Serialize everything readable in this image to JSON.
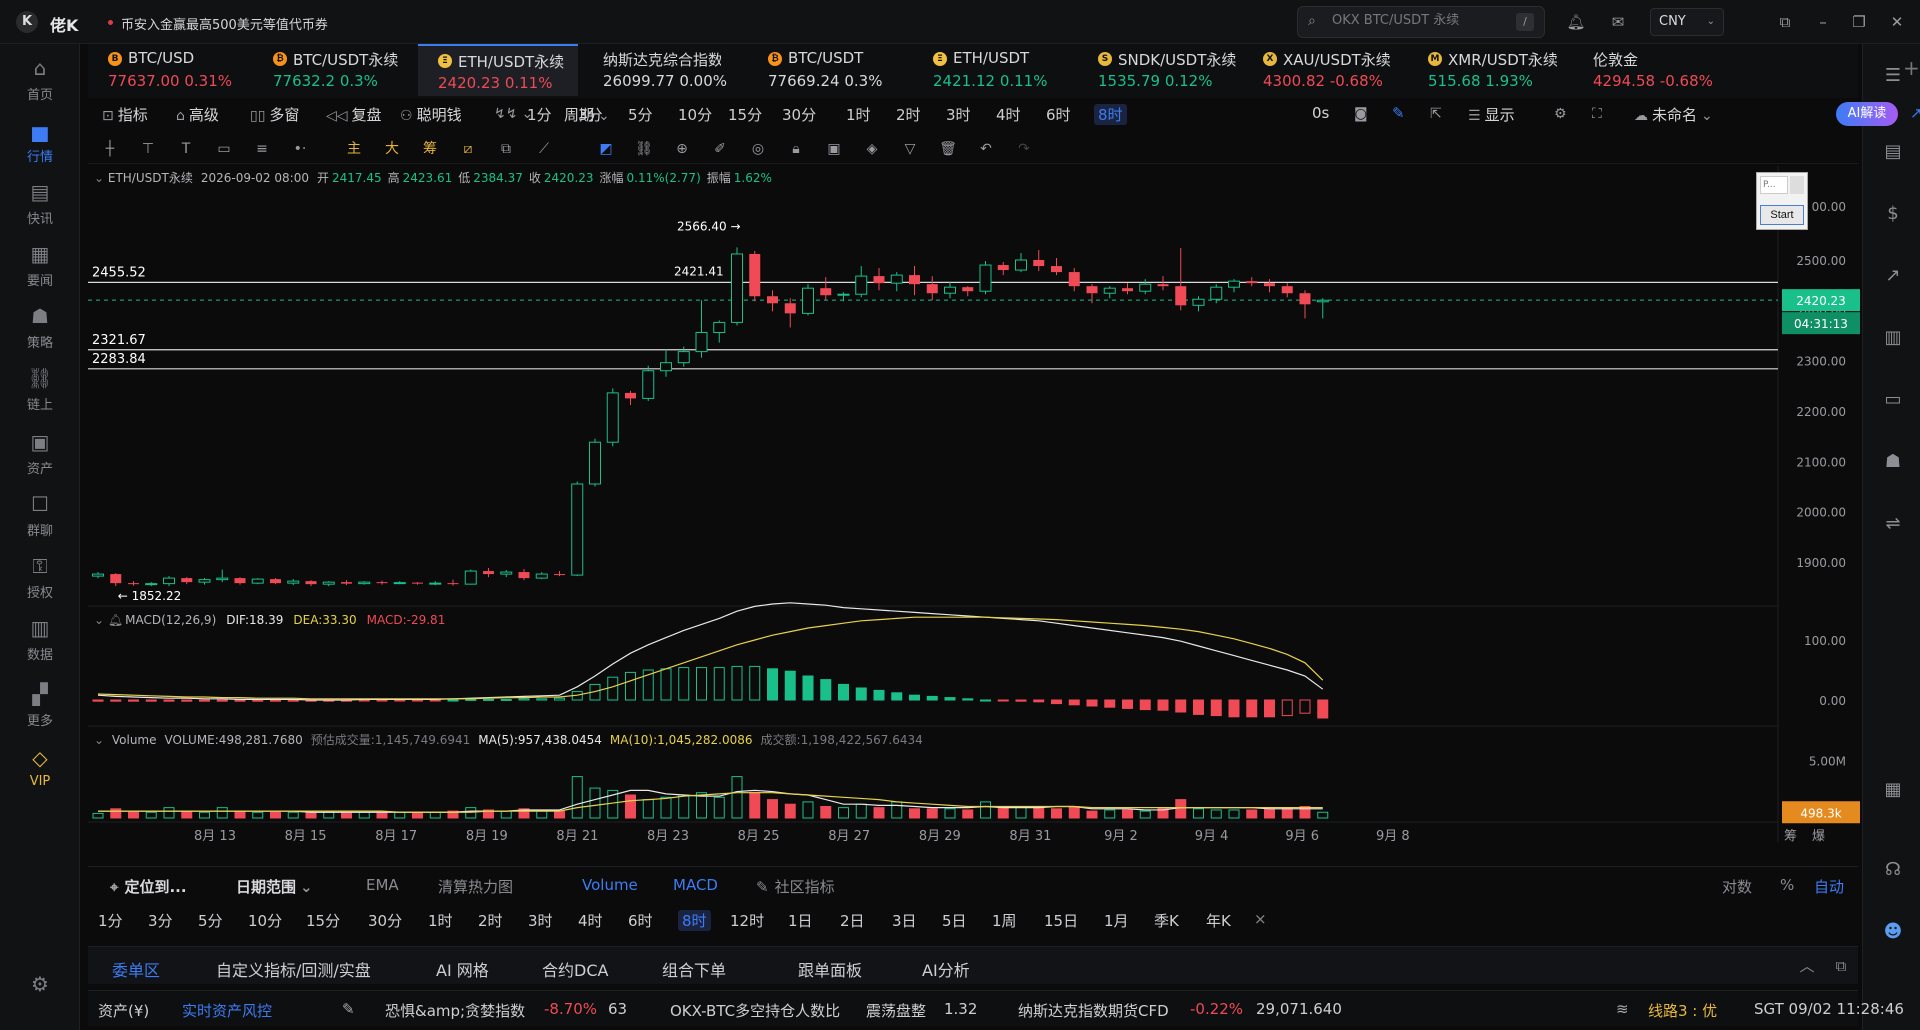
{
  "app": {
    "title": "佬K",
    "logo": "K"
  },
  "headline": "币安入金赢最高500美元等值代币券",
  "search": {
    "placeholder": "OKX BTC/USDT 永续",
    "shortcut": "/"
  },
  "currency": "CNY",
  "sidebar": [
    {
      "label": "首页",
      "icon": "home-icon"
    },
    {
      "label": "行情",
      "icon": "chart-bars-icon",
      "active": true
    },
    {
      "label": "快讯",
      "icon": "news-icon"
    },
    {
      "label": "要闻",
      "icon": "article-icon"
    },
    {
      "label": "策略",
      "icon": "robot-icon"
    },
    {
      "label": "链上",
      "icon": "chain-icon"
    },
    {
      "label": "资产",
      "icon": "wallet-icon"
    },
    {
      "label": "群聊",
      "icon": "chat-icon"
    },
    {
      "label": "授权",
      "icon": "key-icon"
    },
    {
      "label": "数据",
      "icon": "data-icon"
    },
    {
      "label": "更多",
      "icon": "grid-icon"
    },
    {
      "label": "VIP",
      "icon": "diamond-icon"
    }
  ],
  "tickers": [
    {
      "name": "BTC/USD",
      "price": "77637.00",
      "change": "0.31%",
      "dir": "dn",
      "icon": "B",
      "color": "#f7931a"
    },
    {
      "name": "BTC/USDT永续",
      "price": "77632.2",
      "change": "0.3%",
      "dir": "up",
      "icon": "₿",
      "color": "#f7931a"
    },
    {
      "name": "ETH/USDT永续",
      "price": "2420.23",
      "change": "0.11%",
      "dir": "dn",
      "icon": "Ξ",
      "color": "#f0c040",
      "active": true
    },
    {
      "name": "纳斯达克综合指数",
      "price": "26099.77",
      "change": "0.00%",
      "dir": "flat",
      "icon": ""
    },
    {
      "name": "BTC/USDT",
      "price": "77669.24",
      "change": "0.3%",
      "dir": "flat",
      "icon": "₿",
      "color": "#f7931a"
    },
    {
      "name": "ETH/USDT",
      "price": "2421.12",
      "change": "0.11%",
      "dir": "up",
      "icon": "Ξ",
      "color": "#f0c040"
    },
    {
      "name": "SNDK/USDT永续",
      "price": "1535.79",
      "change": "0.12%",
      "dir": "up",
      "icon": "S",
      "color": "#e6b93c"
    },
    {
      "name": "XAU/USDT永续",
      "price": "4300.82",
      "change": "-0.68%",
      "dir": "dn",
      "icon": "X",
      "color": "#e6b93c"
    },
    {
      "name": "XMR/USDT永续",
      "price": "515.68",
      "change": "1.93%",
      "dir": "up",
      "icon": "M",
      "color": "#e6b93c"
    },
    {
      "name": "伦敦金",
      "price": "4294.58",
      "change": "-0.68%",
      "dir": "dn",
      "icon": ""
    }
  ],
  "toolbar": {
    "indicators": "指标",
    "advanced": "高级",
    "multi": "多窗",
    "replay": "复盘",
    "smart": "聪明钱",
    "period": "周期",
    "periods": [
      "1分",
      "3分",
      "5分",
      "10分",
      "15分",
      "30分",
      "1时",
      "2时",
      "3时",
      "4时",
      "6时",
      "8时"
    ],
    "active_period": "8时",
    "countdown": "0s",
    "display": "显示",
    "unnamed": "未命名",
    "ai": "AI解读"
  },
  "chart_info": {
    "symbol": "ETH/USDT永续",
    "time": "2026-09-02 08:00",
    "open_label": "开",
    "open": "2417.45",
    "high_label": "高",
    "high": "2423.61",
    "low_label": "低",
    "low": "2384.37",
    "close_label": "收",
    "close": "2420.23",
    "change_label": "涨幅",
    "change": "0.11%(2.77)",
    "amp_label": "振幅",
    "amp": "1.62%"
  },
  "macd_info": {
    "name": "MACD(12,26,9)",
    "dif": "DIF:18.39",
    "dea": "DEA:33.30",
    "macd": "MACD:-29.81"
  },
  "volume_info": {
    "name": "Volume",
    "volume": "VOLUME:498,281.7680",
    "est": "预估成交量:1,145,749.6941",
    "ma5": "MA(5):957,438.0454",
    "ma10": "MA(10):1,045,282.0086",
    "turnover": "成交额:1,198,422,567.6434"
  },
  "price_labels": {
    "current": "2420.23",
    "countdown": "04:31:13",
    "volume_last": "498.3k",
    "lines": [
      "2455.52",
      "2321.67",
      "2283.84"
    ],
    "high_mark": "2566.40",
    "low_mark": "1852.22",
    "mid_mark": "2421.41"
  },
  "chart_data": {
    "type": "candlestick",
    "ylim": [
      1850,
      2600
    ],
    "yticks": [
      "2500.00",
      "2400.00",
      "2300.00",
      "2200.00",
      "2100.00",
      "2000.00",
      "1900.00"
    ],
    "top_tick": "00.00",
    "macd_ticks": [
      "100.00",
      "0.00"
    ],
    "vol_ticks": [
      "5.00M"
    ],
    "xticks": [
      "8月 13",
      "8月 15",
      "8月 17",
      "8月 19",
      "8月 21",
      "8月 23",
      "8月 25",
      "8月 27",
      "8月 29",
      "8月 31",
      "9月 2",
      "9月 4",
      "9月 6",
      "9月 8"
    ],
    "candles": [
      [
        1872,
        1880,
        1868,
        1876
      ],
      [
        1876,
        1878,
        1852,
        1858
      ],
      [
        1858,
        1862,
        1853,
        1856
      ],
      [
        1856,
        1860,
        1852,
        1857
      ],
      [
        1857,
        1872,
        1852,
        1868
      ],
      [
        1868,
        1870,
        1856,
        1860
      ],
      [
        1860,
        1868,
        1855,
        1865
      ],
      [
        1865,
        1885,
        1860,
        1868
      ],
      [
        1868,
        1870,
        1855,
        1858
      ],
      [
        1858,
        1868,
        1856,
        1866
      ],
      [
        1866,
        1868,
        1856,
        1858
      ],
      [
        1858,
        1866,
        1854,
        1862
      ],
      [
        1862,
        1864,
        1852,
        1856
      ],
      [
        1856,
        1862,
        1852,
        1860
      ],
      [
        1860,
        1864,
        1854,
        1857
      ],
      [
        1857,
        1862,
        1855,
        1860
      ],
      [
        1860,
        1863,
        1855,
        1858
      ],
      [
        1858,
        1862,
        1856,
        1859
      ],
      [
        1859,
        1860,
        1855,
        1857
      ],
      [
        1857,
        1862,
        1854,
        1858
      ],
      [
        1858,
        1865,
        1853,
        1856
      ],
      [
        1856,
        1885,
        1855,
        1882
      ],
      [
        1882,
        1888,
        1870,
        1876
      ],
      [
        1876,
        1884,
        1870,
        1880
      ],
      [
        1880,
        1886,
        1864,
        1868
      ],
      [
        1868,
        1880,
        1866,
        1876
      ],
      [
        1876,
        1882,
        1872,
        1874
      ],
      [
        1874,
        2060,
        1872,
        2055
      ],
      [
        2055,
        2145,
        2050,
        2138
      ],
      [
        2138,
        2245,
        2130,
        2236
      ],
      [
        2236,
        2240,
        2212,
        2225
      ],
      [
        2225,
        2290,
        2220,
        2280
      ],
      [
        2280,
        2322,
        2268,
        2296
      ],
      [
        2296,
        2328,
        2288,
        2318
      ],
      [
        2318,
        2420,
        2306,
        2356
      ],
      [
        2356,
        2380,
        2336,
        2376
      ],
      [
        2376,
        2525,
        2370,
        2512
      ],
      [
        2512,
        2518,
        2418,
        2428
      ],
      [
        2428,
        2440,
        2398,
        2414
      ],
      [
        2414,
        2424,
        2366,
        2394
      ],
      [
        2394,
        2452,
        2390,
        2444
      ],
      [
        2444,
        2466,
        2420,
        2430
      ],
      [
        2430,
        2436,
        2418,
        2432
      ],
      [
        2432,
        2488,
        2426,
        2468
      ],
      [
        2468,
        2484,
        2440,
        2454
      ],
      [
        2454,
        2476,
        2438,
        2470
      ],
      [
        2470,
        2488,
        2430,
        2452
      ],
      [
        2452,
        2468,
        2420,
        2434
      ],
      [
        2434,
        2456,
        2424,
        2446
      ],
      [
        2446,
        2448,
        2428,
        2438
      ],
      [
        2438,
        2498,
        2432,
        2490
      ],
      [
        2490,
        2496,
        2470,
        2480
      ],
      [
        2480,
        2514,
        2476,
        2500
      ],
      [
        2500,
        2520,
        2478,
        2488
      ],
      [
        2488,
        2504,
        2470,
        2476
      ],
      [
        2476,
        2484,
        2438,
        2448
      ],
      [
        2448,
        2452,
        2414,
        2434
      ],
      [
        2434,
        2448,
        2424,
        2444
      ],
      [
        2444,
        2454,
        2432,
        2438
      ],
      [
        2438,
        2462,
        2432,
        2452
      ],
      [
        2452,
        2468,
        2440,
        2448
      ],
      [
        2448,
        2524,
        2400,
        2410
      ],
      [
        2410,
        2428,
        2398,
        2422
      ],
      [
        2422,
        2452,
        2414,
        2446
      ],
      [
        2446,
        2462,
        2436,
        2458
      ],
      [
        2458,
        2466,
        2448,
        2454
      ],
      [
        2454,
        2462,
        2436,
        2448
      ],
      [
        2448,
        2454,
        2426,
        2434
      ],
      [
        2434,
        2440,
        2384,
        2412
      ],
      [
        2417,
        2424,
        2384,
        2420
      ]
    ],
    "macd_dif": [
      8,
      6,
      5,
      4,
      3,
      3,
      2,
      2,
      1,
      1,
      1,
      1,
      0,
      0,
      0,
      1,
      1,
      1,
      1,
      1,
      2,
      3,
      4,
      5,
      6,
      7,
      8,
      22,
      40,
      60,
      78,
      92,
      104,
      116,
      126,
      136,
      148,
      156,
      160,
      162,
      160,
      158,
      154,
      152,
      150,
      148,
      146,
      144,
      142,
      140,
      138,
      136,
      134,
      132,
      128,
      124,
      120,
      116,
      112,
      108,
      104,
      98,
      90,
      82,
      74,
      66,
      58,
      50,
      40,
      18
    ],
    "macd_dea": [
      10,
      9,
      8,
      7,
      6,
      5,
      5,
      4,
      4,
      3,
      3,
      3,
      2,
      2,
      2,
      2,
      2,
      2,
      2,
      2,
      2,
      2,
      3,
      4,
      4,
      5,
      5,
      8,
      14,
      22,
      32,
      42,
      52,
      62,
      72,
      82,
      92,
      100,
      108,
      114,
      120,
      124,
      128,
      132,
      134,
      136,
      138,
      138,
      138,
      138,
      138,
      137,
      136,
      135,
      134,
      132,
      130,
      128,
      126,
      124,
      121,
      118,
      114,
      108,
      102,
      94,
      86,
      76,
      62,
      33
    ],
    "macd_hist": [
      -2,
      -2,
      -2,
      -2,
      -2,
      -2,
      -2,
      -2,
      -2,
      -2,
      -2,
      -2,
      -2,
      -2,
      -2,
      -1,
      -1,
      -1,
      -1,
      -1,
      0,
      1,
      1,
      1,
      2,
      2,
      3,
      14,
      26,
      38,
      46,
      50,
      52,
      54,
      54,
      54,
      56,
      56,
      52,
      48,
      40,
      34,
      26,
      20,
      16,
      12,
      8,
      6,
      4,
      2,
      0,
      -1,
      -2,
      -3,
      -6,
      -8,
      -10,
      -12,
      -14,
      -16,
      -17,
      -20,
      -24,
      -26,
      -28,
      -28,
      -28,
      -26,
      -22,
      -30
    ],
    "volume": [
      0.4,
      0.8,
      0.5,
      0.5,
      0.9,
      0.6,
      0.5,
      0.9,
      0.6,
      0.5,
      0.5,
      0.5,
      0.6,
      0.5,
      0.5,
      0.5,
      0.5,
      0.5,
      0.5,
      0.5,
      0.6,
      0.9,
      0.7,
      0.6,
      0.8,
      0.6,
      0.6,
      3.6,
      2.6,
      2.4,
      2.0,
      1.6,
      1.8,
      2.0,
      2.2,
      1.8,
      3.6,
      2.2,
      1.6,
      1.2,
      1.4,
      1.0,
      0.9,
      1.2,
      0.9,
      1.4,
      0.8,
      0.8,
      0.8,
      0.7,
      1.4,
      0.9,
      1.0,
      0.9,
      0.8,
      1.0,
      0.6,
      0.7,
      0.7,
      0.6,
      0.9,
      1.6,
      0.8,
      0.7,
      0.7,
      0.7,
      0.8,
      0.9,
      1.0,
      0.5
    ],
    "vol_ma5": [
      0.6,
      0.6,
      0.6,
      0.6,
      0.6,
      0.6,
      0.6,
      0.6,
      0.6,
      0.6,
      0.6,
      0.6,
      0.5,
      0.5,
      0.5,
      0.5,
      0.5,
      0.5,
      0.5,
      0.5,
      0.5,
      0.6,
      0.6,
      0.6,
      0.7,
      0.7,
      0.7,
      1.2,
      1.6,
      2.0,
      2.4,
      2.4,
      2.1,
      2.0,
      1.9,
      1.9,
      2.3,
      2.4,
      2.3,
      2.1,
      2.0,
      1.6,
      1.2,
      1.2,
      1.1,
      1.1,
      1.0,
      0.9,
      0.9,
      0.9,
      1.0,
      0.9,
      0.9,
      0.9,
      1.0,
      1.0,
      0.8,
      0.8,
      0.8,
      0.7,
      0.7,
      0.9,
      0.9,
      0.9,
      0.9,
      0.9,
      0.8,
      0.8,
      0.8,
      0.8
    ],
    "vol_ma10": [
      0.6,
      0.6,
      0.6,
      0.6,
      0.6,
      0.6,
      0.6,
      0.6,
      0.6,
      0.6,
      0.6,
      0.6,
      0.6,
      0.6,
      0.6,
      0.6,
      0.6,
      0.5,
      0.5,
      0.5,
      0.5,
      0.5,
      0.6,
      0.6,
      0.6,
      0.6,
      0.6,
      0.9,
      1.1,
      1.3,
      1.5,
      1.6,
      1.7,
      1.9,
      2.0,
      2.1,
      2.2,
      2.2,
      2.2,
      2.1,
      2.0,
      1.9,
      1.8,
      1.7,
      1.6,
      1.4,
      1.3,
      1.2,
      1.1,
      1.0,
      1.0,
      1.0,
      1.0,
      1.0,
      1.0,
      1.0,
      0.9,
      0.9,
      0.9,
      0.9,
      0.9,
      0.9,
      0.9,
      0.9,
      0.9,
      0.9,
      0.9,
      0.9,
      0.9,
      0.9
    ]
  },
  "bottom": {
    "locate": "定位到...",
    "date_range": "日期范围",
    "ind_tabs": [
      "EMA",
      "清算热力图",
      "Volume",
      "MACD",
      "社区指标"
    ],
    "scale": [
      "对数",
      "%",
      "自动"
    ],
    "periods2": [
      "1分",
      "3分",
      "5分",
      "10分",
      "15分",
      "30分",
      "1时",
      "2时",
      "3时",
      "4时",
      "6时",
      "8时",
      "12时",
      "1日",
      "2日",
      "3日",
      "5日",
      "1周",
      "15日",
      "1月",
      "季K",
      "年K"
    ],
    "active_period2": "8时",
    "panel_tabs": [
      "委单区",
      "自定义指标/回测/实盘",
      "AI 网格",
      "合约DCA",
      "组合下单",
      "跟单面板",
      "AI分析"
    ]
  },
  "status": {
    "assets": "资产(¥)",
    "risk": "实时资产风控",
    "fear": "恐惧&amp;贪婪指数",
    "fear_change": "-8.70%",
    "fear_value": "63",
    "okx_ratio": "OKX-BTC多空持仓人数比",
    "ratio_state": "震荡盘整",
    "ratio_value": "1.32",
    "nasdaq": "纳斯达克指数期货CFD",
    "nasdaq_change": "-0.22%",
    "nasdaq_value": "29,071.640",
    "line": "线路3 : 优",
    "clock": "SGT 09/02 11:28:46"
  },
  "overlay": {
    "placeholder": "P...",
    "start": "Start"
  },
  "colors": {
    "up": "#19c08a",
    "down": "#ef4a55",
    "accent": "#3d7cf4",
    "macd_dif": "#e8e8e8",
    "macd_dea": "#e6d24a"
  }
}
